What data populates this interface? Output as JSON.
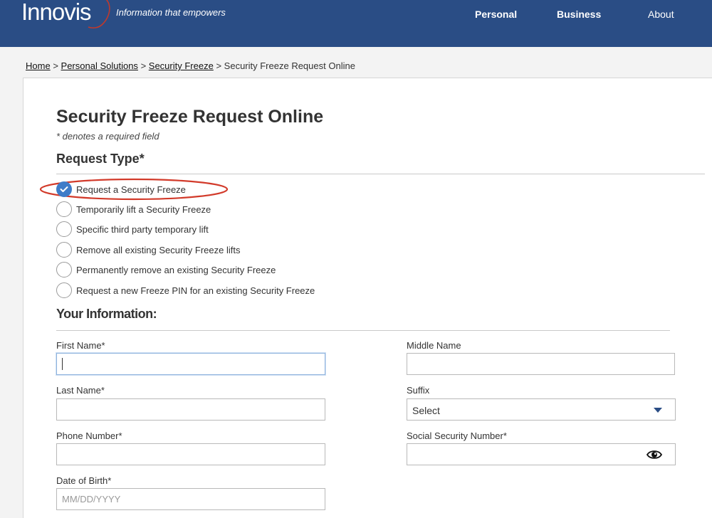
{
  "header": {
    "logo_text": "Innovis",
    "tagline": "Information that empowers",
    "nav": [
      "Personal",
      "Business",
      "About"
    ]
  },
  "breadcrumb": {
    "links": [
      "Home",
      "Personal Solutions",
      "Security Freeze"
    ],
    "current": "Security Freeze Request Online",
    "separator": ">"
  },
  "page": {
    "title": "Security Freeze Request Online",
    "required_note": "* denotes a required field"
  },
  "request_type": {
    "heading": "Request Type*",
    "options": [
      "Request a Security Freeze",
      "Temporarily lift a Security Freeze",
      "Specific third party temporary lift",
      "Remove all existing Security Freeze lifts",
      "Permanently remove an existing Security Freeze",
      "Request a new Freeze PIN for an existing Security Freeze"
    ],
    "selected_index": 0
  },
  "your_info": {
    "heading": "Your Information:",
    "first_name": {
      "label": "First Name*",
      "value": ""
    },
    "middle_name": {
      "label": "Middle Name",
      "value": ""
    },
    "last_name": {
      "label": "Last Name*",
      "value": ""
    },
    "suffix": {
      "label": "Suffix",
      "value": "Select"
    },
    "phone": {
      "label": "Phone Number*",
      "value": ""
    },
    "ssn": {
      "label": "Social Security Number*",
      "value": ""
    },
    "dob": {
      "label": "Date of Birth*",
      "placeholder": "MM/DD/YYYY"
    }
  },
  "colors": {
    "header_bg": "#2a4d85",
    "radio_checked": "#3e7cc8",
    "annotation": "#d23a2a",
    "logo_swoosh": "#c0392b"
  }
}
